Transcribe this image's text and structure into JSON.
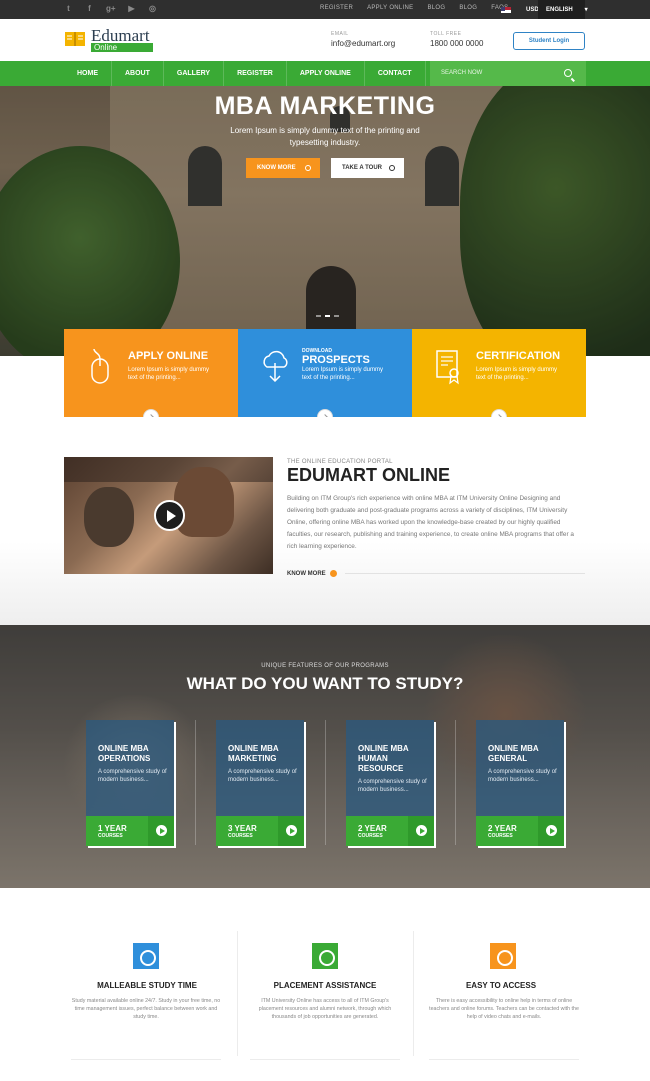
{
  "topbar": {
    "social": [
      "twitter-icon",
      "facebook-icon",
      "google-plus-icon",
      "youtube-icon",
      "instagram-icon"
    ],
    "links": [
      "REGISTER",
      "APPLY ONLINE",
      "BLOG",
      "BLOG",
      "FAQS"
    ],
    "currency": "USD",
    "language": "ENGLISH"
  },
  "header": {
    "logo_text": "Edumart",
    "logo_sub": "Online",
    "email_label": "EMAIL",
    "email": "info@edumart.org",
    "phone_label": "TOLL FREE",
    "phone": "1800 000 0000",
    "login_label": "Student Login"
  },
  "nav": {
    "items": [
      "HOME",
      "ABOUT",
      "GALLERY",
      "REGISTER",
      "APPLY ONLINE",
      "CONTACT"
    ],
    "search_placeholder": "SEARCH NOW"
  },
  "hero": {
    "title": "MBA MARKETING",
    "text": "Lorem Ipsum is simply dummy text of the printing and typesetting industry.",
    "btn_know": "KNOW MORE",
    "btn_tour": "TAKE A TOUR"
  },
  "features": [
    {
      "pre": "",
      "title": "APPLY ONLINE",
      "desc": "Lorem Ipsum is simply dummy text of the printing...",
      "color": "#f7941d"
    },
    {
      "pre": "DOWNLOAD",
      "title": "PROSPECTS",
      "desc": "Lorem Ipsum is simply dummy text of the printing...",
      "color": "#2f8fdb"
    },
    {
      "pre": "",
      "title": "CERTIFICATION",
      "desc": "Lorem Ipsum is simply dummy text of the printing...",
      "color": "#f4b400"
    }
  ],
  "about": {
    "kicker": "THE ONLINE EDUCATION PORTAL",
    "title": "EDUMART ONLINE",
    "text": "Building on ITM Group's rich experience with online MBA at ITM University Online Designing and delivering both graduate and post-graduate programs across a variety of disciplines, ITM University Online, offering online MBA has worked upon the knowledge-base created by our highly qualified faculties, our research, publishing and training experience, to create online MBA programs that offer a rich learning experience.",
    "more": "KNOW MORE"
  },
  "programs": {
    "kicker": "UNIQUE FEATURES OF OUR PROGRAMS",
    "title": "WHAT DO YOU WANT TO STUDY?",
    "cards": [
      {
        "title": "ONLINE MBA OPERATIONS",
        "desc": "A comprehensive study of modern business...",
        "years": "1 YEAR",
        "unit": "COURSES"
      },
      {
        "title": "ONLINE MBA MARKETING",
        "desc": "A comprehensive study of modern business...",
        "years": "3 YEAR",
        "unit": "COURSES"
      },
      {
        "title": "ONLINE MBA HUMAN RESOURCE",
        "desc": "A comprehensive study of modern business...",
        "years": "2 YEAR",
        "unit": "COURSES"
      },
      {
        "title": "ONLINE MBA GENERAL",
        "desc": "A comprehensive study of modern business...",
        "years": "2 YEAR",
        "unit": "COURSES"
      }
    ]
  },
  "bottom": [
    {
      "title": "MALLEABLE STUDY TIME",
      "text": "Study material available online 24/7. Study in your free time, no time management issues, perfect balance between work and study time.",
      "color": "#2f8fdb"
    },
    {
      "title": "PLACEMENT ASSISTANCE",
      "text": "ITM University Online has access to all of ITM Group's placement resources and alumni network, through which thousands of job opportunities are generated.",
      "color": "#3aaa35"
    },
    {
      "title": "EASY TO ACCESS",
      "text": "There is easy accessibility to online help in terms of online teachers and online forums. Teachers can be contacted with the help of video chats and e-mails.",
      "color": "#f7941d"
    }
  ]
}
